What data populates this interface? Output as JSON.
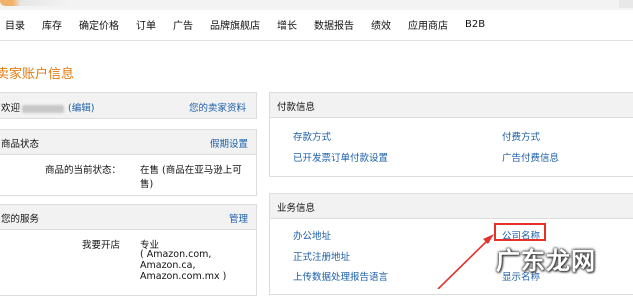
{
  "nav": {
    "items": [
      "目录",
      "库存",
      "确定价格",
      "订单",
      "广告",
      "品牌旗舰店",
      "增长",
      "数据报告",
      "绩效",
      "应用商店",
      "B2B"
    ]
  },
  "page": {
    "title": "卖家账户信息"
  },
  "welcome_panel": {
    "greeting": "欢迎",
    "edit_link": "(编辑)",
    "profile_link": "您的卖家资料"
  },
  "listing_panel": {
    "title": "商品状态",
    "action": "假期设置",
    "label": "商品的当前状态：",
    "status_line1": "在售 (商品在亚马逊上可",
    "status_line2": "售)"
  },
  "services_panel": {
    "title": "您的服务",
    "action": "管理",
    "label": "我要开店",
    "plan": "专业",
    "sites_line1": "( Amazon.com,",
    "sites_line2": "Amazon.ca,",
    "sites_line3": "Amazon.com.mx )"
  },
  "payment_panel": {
    "title": "付款信息",
    "links": {
      "deposit": "存款方式",
      "charge": "付费方式",
      "invoice": "已开发票订单付款设置",
      "ad_charge": "广告付费信息"
    }
  },
  "business_panel": {
    "title": "业务信息",
    "links": {
      "office": "办公地址",
      "company_name": "公司名称",
      "registered": "正式注册地址",
      "display_name": "显示名称",
      "language": "上传数据处理报告语言"
    }
  },
  "watermark": "广东龙网",
  "colors": {
    "accent_orange": "#e47911",
    "link_blue": "#1b5fa8",
    "highlight_red": "#e4312b"
  }
}
